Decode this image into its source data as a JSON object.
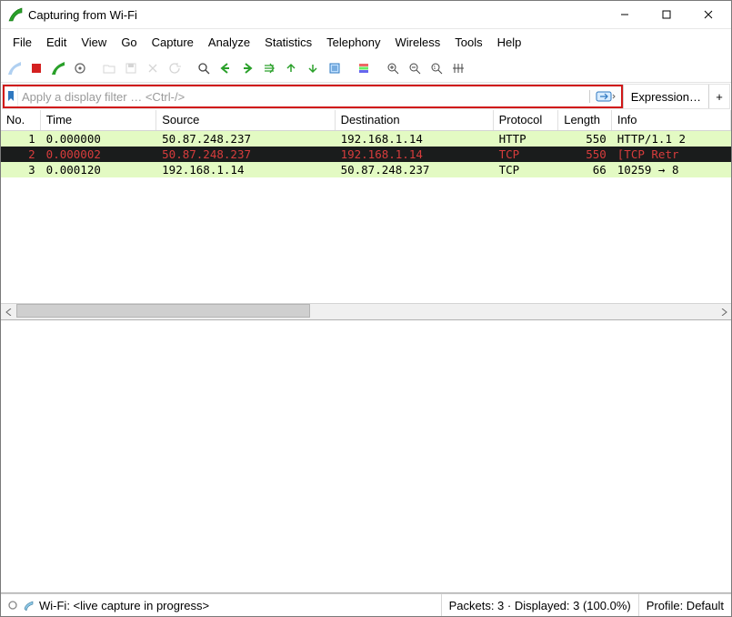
{
  "window": {
    "title": "Capturing from Wi-Fi"
  },
  "menu": {
    "items": [
      "File",
      "Edit",
      "View",
      "Go",
      "Capture",
      "Analyze",
      "Statistics",
      "Telephony",
      "Wireless",
      "Tools",
      "Help"
    ]
  },
  "filter": {
    "placeholder": "Apply a display filter … <Ctrl-/>",
    "expression_label": "Expression…",
    "plus_label": "+"
  },
  "packet_table": {
    "columns": [
      "No.",
      "Time",
      "Source",
      "Destination",
      "Protocol",
      "Length",
      "Info"
    ],
    "rows": [
      {
        "no": "1",
        "time": "0.000000",
        "src": "50.87.248.237",
        "dst": "192.168.1.14",
        "proto": "HTTP",
        "len": "550",
        "info": "HTTP/1.1 2",
        "class": "row-http"
      },
      {
        "no": "2",
        "time": "0.000002",
        "src": "50.87.248.237",
        "dst": "192.168.1.14",
        "proto": "TCP",
        "len": "550",
        "info": "[TCP Retr",
        "class": "row-selected"
      },
      {
        "no": "3",
        "time": "0.000120",
        "src": "192.168.1.14",
        "dst": "50.87.248.237",
        "proto": "TCP",
        "len": "66",
        "info": "10259 → 8",
        "class": "row-tcp"
      }
    ]
  },
  "status": {
    "iface": "Wi-Fi: <live capture in progress>",
    "packets": "Packets: 3 · Displayed: 3 (100.0%)",
    "profile": "Profile: Default"
  }
}
